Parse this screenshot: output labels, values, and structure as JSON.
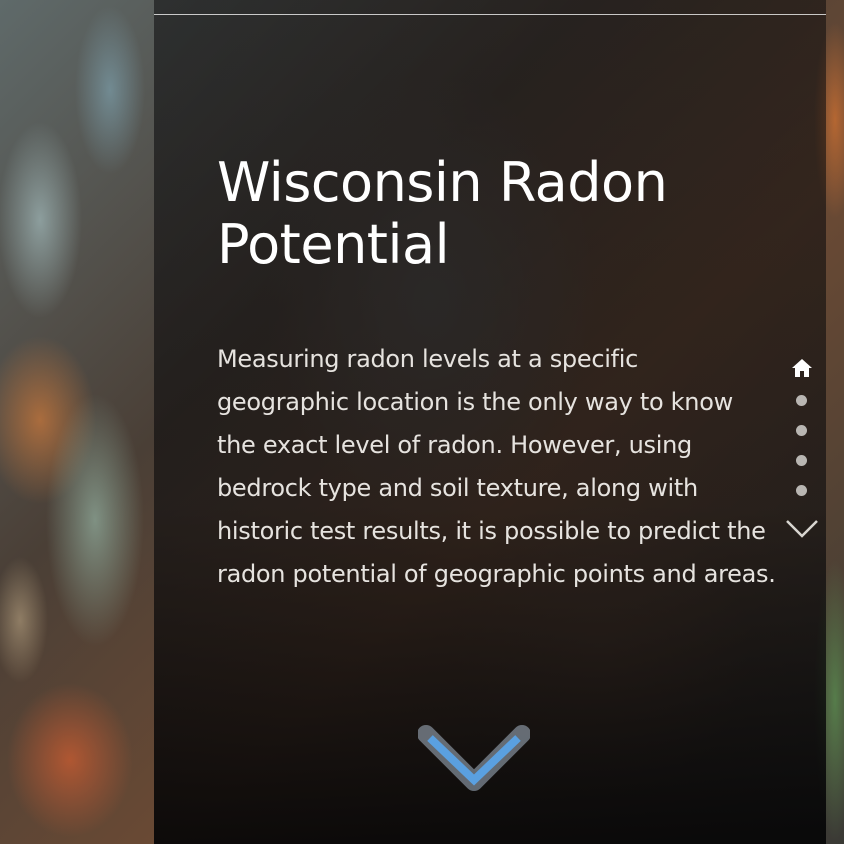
{
  "header": {
    "title": "Wisconsin Radon Potential"
  },
  "intro": {
    "text": "Measuring radon levels at a specific geographic location is the only way to know the exact level of radon. However, using bedrock type and soil texture, along with historic test results, it is possible to predict the radon potential of geographic points and areas."
  },
  "side_nav": {
    "home_icon": "home-icon",
    "dot_count": 4,
    "next_icon": "chevron-down-icon"
  },
  "scroll_indicator": {
    "icon": "chevron-down-icon",
    "color": "#5aa0e0"
  },
  "colors": {
    "panel": "#0a0a0c",
    "title": "#ffffff",
    "body": "#e6e3df",
    "accent": "#5aa0e0"
  }
}
